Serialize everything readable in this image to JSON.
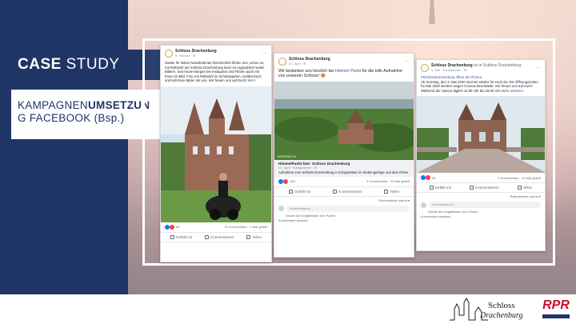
{
  "slide": {
    "title_bold": "CASE",
    "title_rest": " STUDY",
    "subtitle_line1_a": "KAMPAGNEN",
    "subtitle_line1_b": "UMSETZUN",
    "subtitle_line2": "G FACEBOOK (Bsp.)"
  },
  "posts": [
    {
      "page": "Schloss Drachenburg",
      "meta": "9. Februar · ⚙",
      "text": "Danke Ihr lieben Newsletterian Drachenfels fühlen uns, schon so, mit Rollstuhl auf Schloss Drachenburg kann so unglaublich vielen Bildern. Seit heute Morgen bei Instagram und Filmen auch mit Ihnen im Bild. Foto mit Rollstuhl im Schlossgarten, meldet Euch und teilt Eure Bilder mit uns. Wir freuen uns auf Euch!",
      "more": "Mehr",
      "reactions_left": "65",
      "reactions_right": "11 Kommentare · 4 Mal geteilt",
      "actions": [
        "Gefällt mir",
        "Kommentieren",
        "Teilen"
      ]
    },
    {
      "page": "Schloss Drachenburg",
      "meta": "22. April · ⚙",
      "text_a": "Wir bedanken uns herzlich bei ",
      "text_link": "Himmel Punkt",
      "text_b": " für die tolle Aufnahme von unserem Schloss! 😍",
      "img_caption": "INTERAKTIV",
      "share_title": "HimmelPunkt hier: Schloss Drachenburg",
      "share_meta": "22. April · Königswinter · ⚙",
      "share_text": "Aufnahme vom Schloss Drachenburg in Königswinter im Siebengebirge und dem Rhein.",
      "reactions_left": "145",
      "reactions_right": "4 Kommentare · 29 Mal geteilt",
      "actions": [
        "Gefällt mir",
        "Kommentieren",
        "Teilen"
      ],
      "relevance": "Relevanteste zuerst ▾",
      "comment_placeholder": "Kommentieren ...",
      "small_note": "Drücke die Eingabetaste zum Posten.",
      "comment_hint": "Kommentare ansehen"
    },
    {
      "page": "Schloss Drachenburg",
      "page_suffix": " ist in Schloss Drachenburg",
      "meta": "5. Mai · Königswinter · ⚙",
      "text_tag": "#SchlossDrachenburg öffnet die Pforten.",
      "text": "Ab Sonntag, den 3. Mai 2020 sind wir wieder für euch da. Die Öffnungszeiten für Mai 2020 werden wegen Corona beschränkt. Wir freuen uns auf euch!",
      "hours": "Während der Saison täglich 11:00 Uhr bis 18:00 Uhr",
      "more": "Mehr ansehen",
      "reactions_left": "95",
      "reactions_right": "3 Kommentare · 10 Mal geteilt",
      "actions": [
        "Gefällt mir",
        "Kommentieren",
        "Teilen"
      ],
      "relevance": "Relevanteste zuerst ▾",
      "comment_placeholder": "Kommentieren ...",
      "small_note": "Drücke die Eingabetaste zum Posten.",
      "comment_hint": "Kommentare ansehen"
    }
  ],
  "logos": {
    "schloss": "Schloss",
    "schloss_script": "Drachenburg",
    "rpr": "RPR"
  },
  "colors": {
    "navy": "#1f3566",
    "fb_blue": "#1877f2",
    "rpr_red": "#c8102e"
  }
}
